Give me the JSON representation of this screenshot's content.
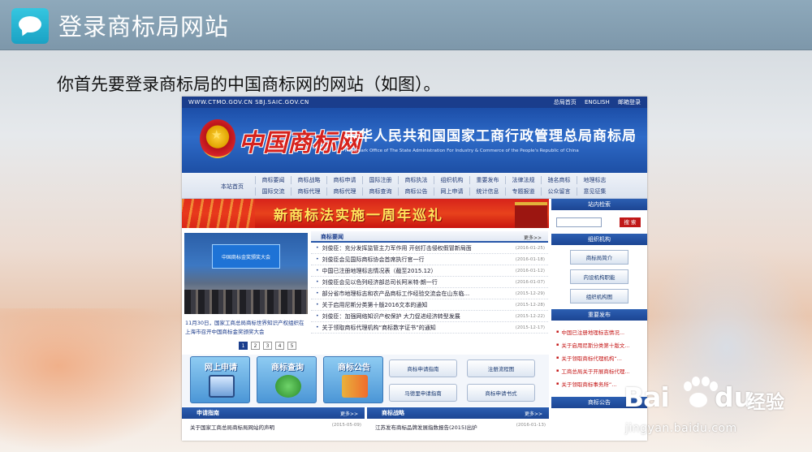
{
  "slide": {
    "title": "登录商标局网站",
    "subtitle": "你首先要登录商标局的中国商标网的网站（如图）。"
  },
  "site": {
    "top_left": "WWW.CTMO.GOV.CN    SBJ.SAIC.GOV.CN",
    "top_links": [
      "总局首页",
      "ENGLISH",
      "邮箱登录"
    ],
    "logo_text": "中国商标网",
    "org_name": "中华人民共和国国家工商行政管理总局商标局",
    "org_en": "Trademark Office of The State Administration For Industry & Commerce of the People's Republic of China",
    "nav_home": "本站首页",
    "nav_row1": [
      "商标要闻",
      "商标战略",
      "商标申请",
      "国际注册",
      "商标执法",
      "组织机构",
      "重要发布",
      "法律法规",
      "驰名商标",
      "地理标志"
    ],
    "nav_row2": [
      "国际交流",
      "商标代理",
      "商标代理",
      "商标查询",
      "商标公告",
      "网上申请",
      "统计信息",
      "专题报道",
      "公众留言",
      "意见征集"
    ],
    "promo": "新商标法实施一周年巡礼",
    "photo_screen": "中国商标金奖颁奖大会",
    "caption": "11月30日，国家工商总局商标世界知识产权组织在上海市召开中国商标金奖颁奖大会",
    "pager": [
      "1",
      "2",
      "3",
      "4",
      "5"
    ],
    "news_title": "商标要闻",
    "more": "更多>>",
    "news": [
      {
        "text": "刘俊臣：充分发挥监管主力军作用 开创打击侵权假冒新局面",
        "date": "(2016-01-25)"
      },
      {
        "text": "刘俊臣会见国际商标协会首席执行官一行",
        "date": "(2016-01-18)"
      },
      {
        "text": "中国已注册地理标志情况表（截至2015.12）",
        "date": "(2016-01-12)"
      },
      {
        "text": "刘俊臣会见以色列经济部总司长阿米特·朗一行",
        "date": "(2016-01-07)"
      },
      {
        "text": "部分省市地理标志和农产品商标工作经验交流会在山东临...",
        "date": "(2015-12-29)"
      },
      {
        "text": "关于启用尼斯分类第十版2016文本的通知",
        "date": "(2015-12-28)"
      },
      {
        "text": "刘俊臣：加强网络知识产权保护 大力促进经济转型发展",
        "date": "(2015-12-22)"
      },
      {
        "text": "关于领取商标代理机构“商标数字证书”的通知",
        "date": "(2015-12-17)"
      }
    ],
    "tiles": [
      "网上申请",
      "商标查询",
      "商标公告"
    ],
    "pills": [
      "商标申请指南",
      "注册流程图",
      "马德里申请指南",
      "商标申请书式"
    ],
    "guide_title": "申请指南",
    "guide_item": {
      "text": "关于国家工商总局商标局网站的声明",
      "date": "(2015-05-09)"
    },
    "strategy_title": "商标战略",
    "strategy_item": {
      "text": "江苏发布商标品牌发展指数报告(2015)出炉",
      "date": "(2016-01-13)"
    },
    "search_title": "站内检索",
    "search_button": "搜 索",
    "org_title": "组织机构",
    "org_buttons": [
      "商标局简介",
      "内设机构职能",
      "组织机构图"
    ],
    "release_title": "重要发布",
    "releases": [
      "中国已注册地理标志情况...",
      "关于启用尼斯分类第十版文...",
      "关于领取商标代理机构“...",
      "工商总局关于开展商标代理...",
      "关于领取商标事务所“..."
    ],
    "announce_title": "商标公告"
  },
  "watermark": {
    "bai": "Bai",
    "du": "du",
    "jingyan": "经验",
    "url": "jingyan.baidu.com"
  },
  "icons": [
    "chat-bubble-icon",
    "national-emblem-icon",
    "computer-icon",
    "globe-icon",
    "books-icon",
    "baidu-paw-icon"
  ]
}
